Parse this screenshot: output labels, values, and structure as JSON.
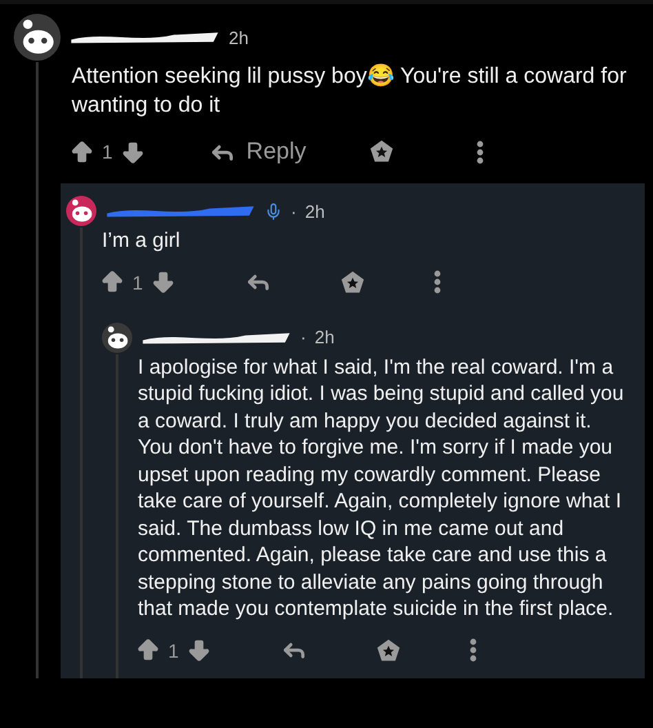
{
  "comments": [
    {
      "color": "#3a3a3a",
      "time": "2h",
      "text": "Attention seeking lil pussy boy😂 You're still a coward for wanting to do it",
      "score": "1",
      "reply_label": "Reply",
      "children": [
        {
          "color": "#c8285a",
          "flair": true,
          "highlighted": true,
          "separator": "·",
          "time": "2h",
          "text": "I’m a girl",
          "score": "1",
          "children": [
            {
              "color": "#3a3a3a",
              "separator": "·",
              "time": "2h",
              "text": "I apologise for what I said, I'm the real coward. I'm a stupid fucking idiot. I was being stupid and called you a coward. I truly am happy you decided against it. You don't have to forgive me. I'm sorry if I made you upset upon reading my cowardly comment. Please take care of yourself. Again, completely ignore what I said. The dumbass low IQ in me came out and commented. Again, please take care and use this a stepping stone to alleviate any pains going through that made you contemplate suicide in the first place.",
              "score": "1"
            }
          ]
        }
      ]
    }
  ]
}
